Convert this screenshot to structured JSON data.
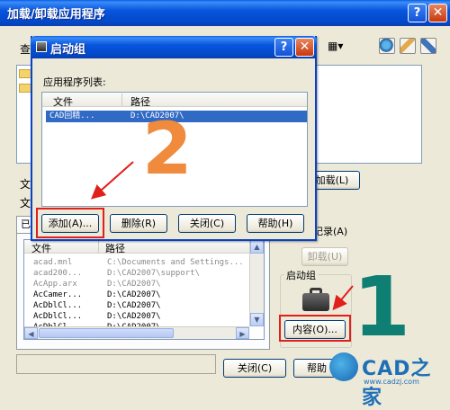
{
  "main_window": {
    "title": "加载/卸载应用程序",
    "help_glyph": "?",
    "close_glyph": "✕",
    "look_in_label_partial": "查",
    "file_label_partial_1": "文",
    "file_label_partial_2": "文",
    "load_button": "加载(L)",
    "add_history_label": "历史记录(A)",
    "unload_button": "卸载(U)",
    "history_tab_partial": "已",
    "list_headers": {
      "file": "文件",
      "path": "路径"
    },
    "list_rows": [
      {
        "file": "acad.mnl",
        "path": "C:\\Documents and Settings...",
        "gray": true
      },
      {
        "file": "acad200...",
        "path": "D:\\CAD2007\\support\\",
        "gray": true
      },
      {
        "file": "AcApp.arx",
        "path": "D:\\CAD2007\\",
        "gray": true
      },
      {
        "file": "AcCamer...",
        "path": "D:\\CAD2007\\",
        "gray": false
      },
      {
        "file": "AcDblCl...",
        "path": "D:\\CAD2007\\",
        "gray": false
      },
      {
        "file": "AcDblCl...",
        "path": "D:\\CAD2007\\",
        "gray": false
      },
      {
        "file": "AcDblCl...",
        "path": "D:\\CAD2007\\",
        "gray": false
      }
    ],
    "startup_group_label": "启动组",
    "contents_button": "内容(O)...",
    "close_button": "关闭(C)",
    "help_button": "帮助"
  },
  "startup_dialog": {
    "title": "启动组",
    "help_glyph": "?",
    "close_glyph": "✕",
    "list_label": "应用程序列表:",
    "headers": {
      "file": "文件",
      "path": "路径"
    },
    "rows": [
      {
        "file": "CAD回精...",
        "path": "D:\\CAD2007\\"
      }
    ],
    "buttons": {
      "add": "添加(A)...",
      "remove": "删除(R)",
      "close": "关闭(C)",
      "help": "帮助(H)"
    }
  },
  "annotations": {
    "step_two": "2",
    "step_one": "1"
  },
  "watermark": {
    "brand": "CAD之家",
    "url": "www.cadzj.com"
  },
  "colors": {
    "annotation_red": "#e0201b",
    "step_two_orange": "#f08a3c",
    "step_one_teal": "#0f7f74",
    "selection": "#316ac5"
  }
}
